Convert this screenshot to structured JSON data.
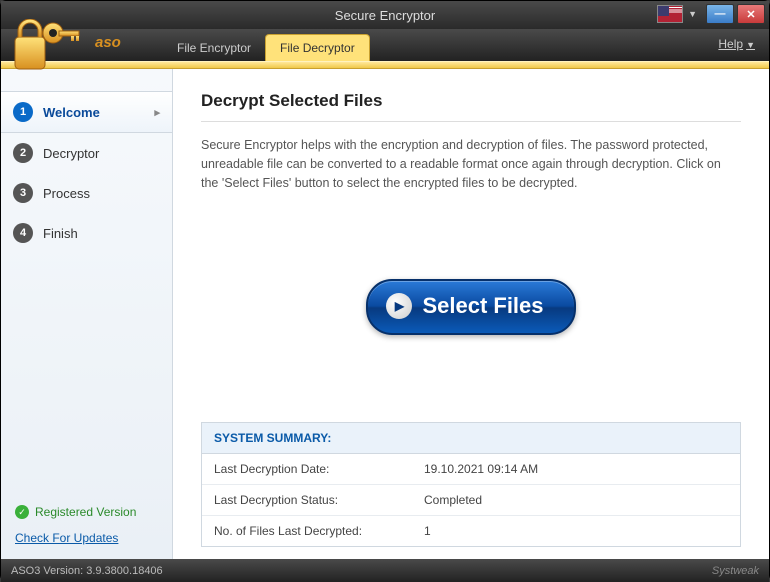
{
  "window": {
    "title": "Secure Encryptor"
  },
  "header": {
    "brand": "aso",
    "tabs": [
      {
        "label": "File Encryptor"
      },
      {
        "label": "File Decryptor"
      }
    ],
    "help": "Help"
  },
  "sidebar": {
    "steps": [
      {
        "num": "1",
        "label": "Welcome"
      },
      {
        "num": "2",
        "label": "Decryptor"
      },
      {
        "num": "3",
        "label": "Process"
      },
      {
        "num": "4",
        "label": "Finish"
      }
    ],
    "registered": "Registered Version",
    "updates": "Check For Updates"
  },
  "content": {
    "heading": "Decrypt Selected Files",
    "description": "Secure Encryptor helps with the encryption and decryption of files. The password protected, unreadable file can be converted to a readable format once again through decryption. Click on the 'Select Files' button to select the encrypted files to be decrypted.",
    "button": "Select Files",
    "summary": {
      "title": "SYSTEM SUMMARY:",
      "rows": [
        {
          "label": "Last Decryption Date:",
          "value": "19.10.2021 09:14 AM"
        },
        {
          "label": "Last Decryption Status:",
          "value": "Completed"
        },
        {
          "label": "No. of Files Last Decrypted:",
          "value": "1"
        }
      ]
    }
  },
  "footer": {
    "version": "ASO3 Version: 3.9.3800.18406",
    "watermark": "Systweak"
  }
}
